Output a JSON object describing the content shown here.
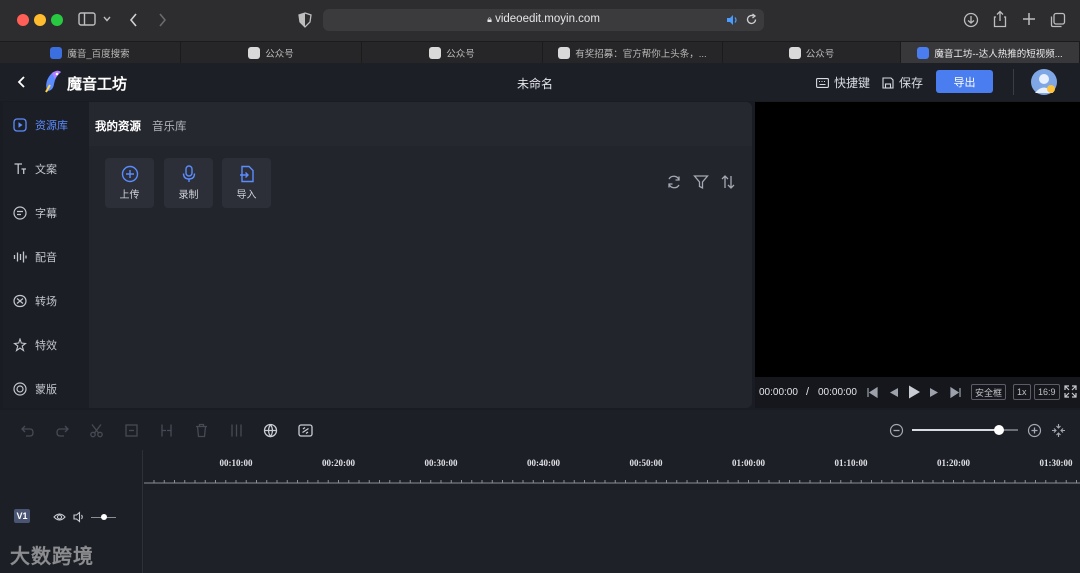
{
  "browser": {
    "url": "videoedit.moyin.com",
    "tabs": [
      {
        "label": "魔音_百度搜索"
      },
      {
        "label": "公众号"
      },
      {
        "label": "公众号"
      },
      {
        "label": "有奖招募：官方帮你上头条，..."
      },
      {
        "label": "公众号"
      },
      {
        "label": "魔音工坊--达人热推的短视频..."
      }
    ]
  },
  "header": {
    "brand": "魔音工坊",
    "doc_title": "未命名",
    "shortcuts_label": "快捷键",
    "save_label": "保存",
    "export_label": "导出"
  },
  "sidebar": {
    "items": [
      {
        "label": "资源库",
        "icon": "play-square-icon",
        "active": true
      },
      {
        "label": "文案",
        "icon": "text-icon"
      },
      {
        "label": "字幕",
        "icon": "subtitle-icon"
      },
      {
        "label": "配音",
        "icon": "waveform-icon"
      },
      {
        "label": "转场",
        "icon": "transition-icon"
      },
      {
        "label": "特效",
        "icon": "sparkle-icon"
      },
      {
        "label": "蒙版",
        "icon": "mask-icon"
      }
    ]
  },
  "panel": {
    "tabs": [
      {
        "label": "我的资源",
        "active": true
      },
      {
        "label": "音乐库"
      }
    ],
    "tools": [
      {
        "label": "上传",
        "icon": "plus-circle-icon"
      },
      {
        "label": "录制",
        "icon": "microphone-icon"
      },
      {
        "label": "导入",
        "icon": "import-icon"
      }
    ]
  },
  "player": {
    "current_time": "00:00:00",
    "separator": "/",
    "total_time": "00:00:00",
    "safe_frame_label": "安全框",
    "speed_label": "1x",
    "ratio_label": "16:9"
  },
  "timeline": {
    "ruler_labels": [
      "00:10:00",
      "00:20:00",
      "00:30:00",
      "00:40:00",
      "00:50:00",
      "01:00:00",
      "01:10:00",
      "01:20:00",
      "01:30:00"
    ],
    "track_label": "V1",
    "zoom_level": 0.82
  },
  "watermark": "大数跨境",
  "colors": {
    "accent": "#4a7df0",
    "active_sidebar": "#5b8cff",
    "background": "#1a1c23"
  }
}
